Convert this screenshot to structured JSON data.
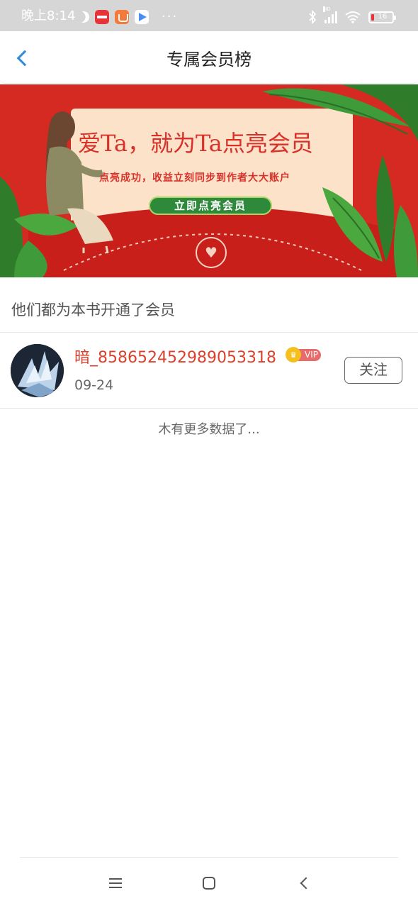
{
  "status_bar": {
    "time": "晚上8:14",
    "more": "···",
    "battery": "16",
    "network": "HD",
    "icons": [
      "moon-icon",
      "app-icon-red",
      "app-icon-orange",
      "app-icon-play",
      "bluetooth-icon",
      "signal-icon",
      "wifi-icon",
      "battery-icon"
    ]
  },
  "header": {
    "title": "专属会员榜",
    "back_icon": "chevron-left-icon",
    "accent_color": "#2d8be0"
  },
  "banner": {
    "title": "爱Ta，就为Ta点亮会员",
    "subtitle": "点亮成功，收益立刻同步到作者大大账户",
    "button_label": "立即点亮会员",
    "background_color": "#d42a22"
  },
  "section": {
    "title": "他们都为本书开通了会员"
  },
  "members": [
    {
      "name": "暗_858652452989053318",
      "badge": "VIP",
      "date": "09-24",
      "follow_label": "关注"
    }
  ],
  "list_footer": "木有更多数据了...",
  "nav_bar": {
    "icons": [
      "menu-icon",
      "home-icon",
      "back-icon"
    ]
  }
}
